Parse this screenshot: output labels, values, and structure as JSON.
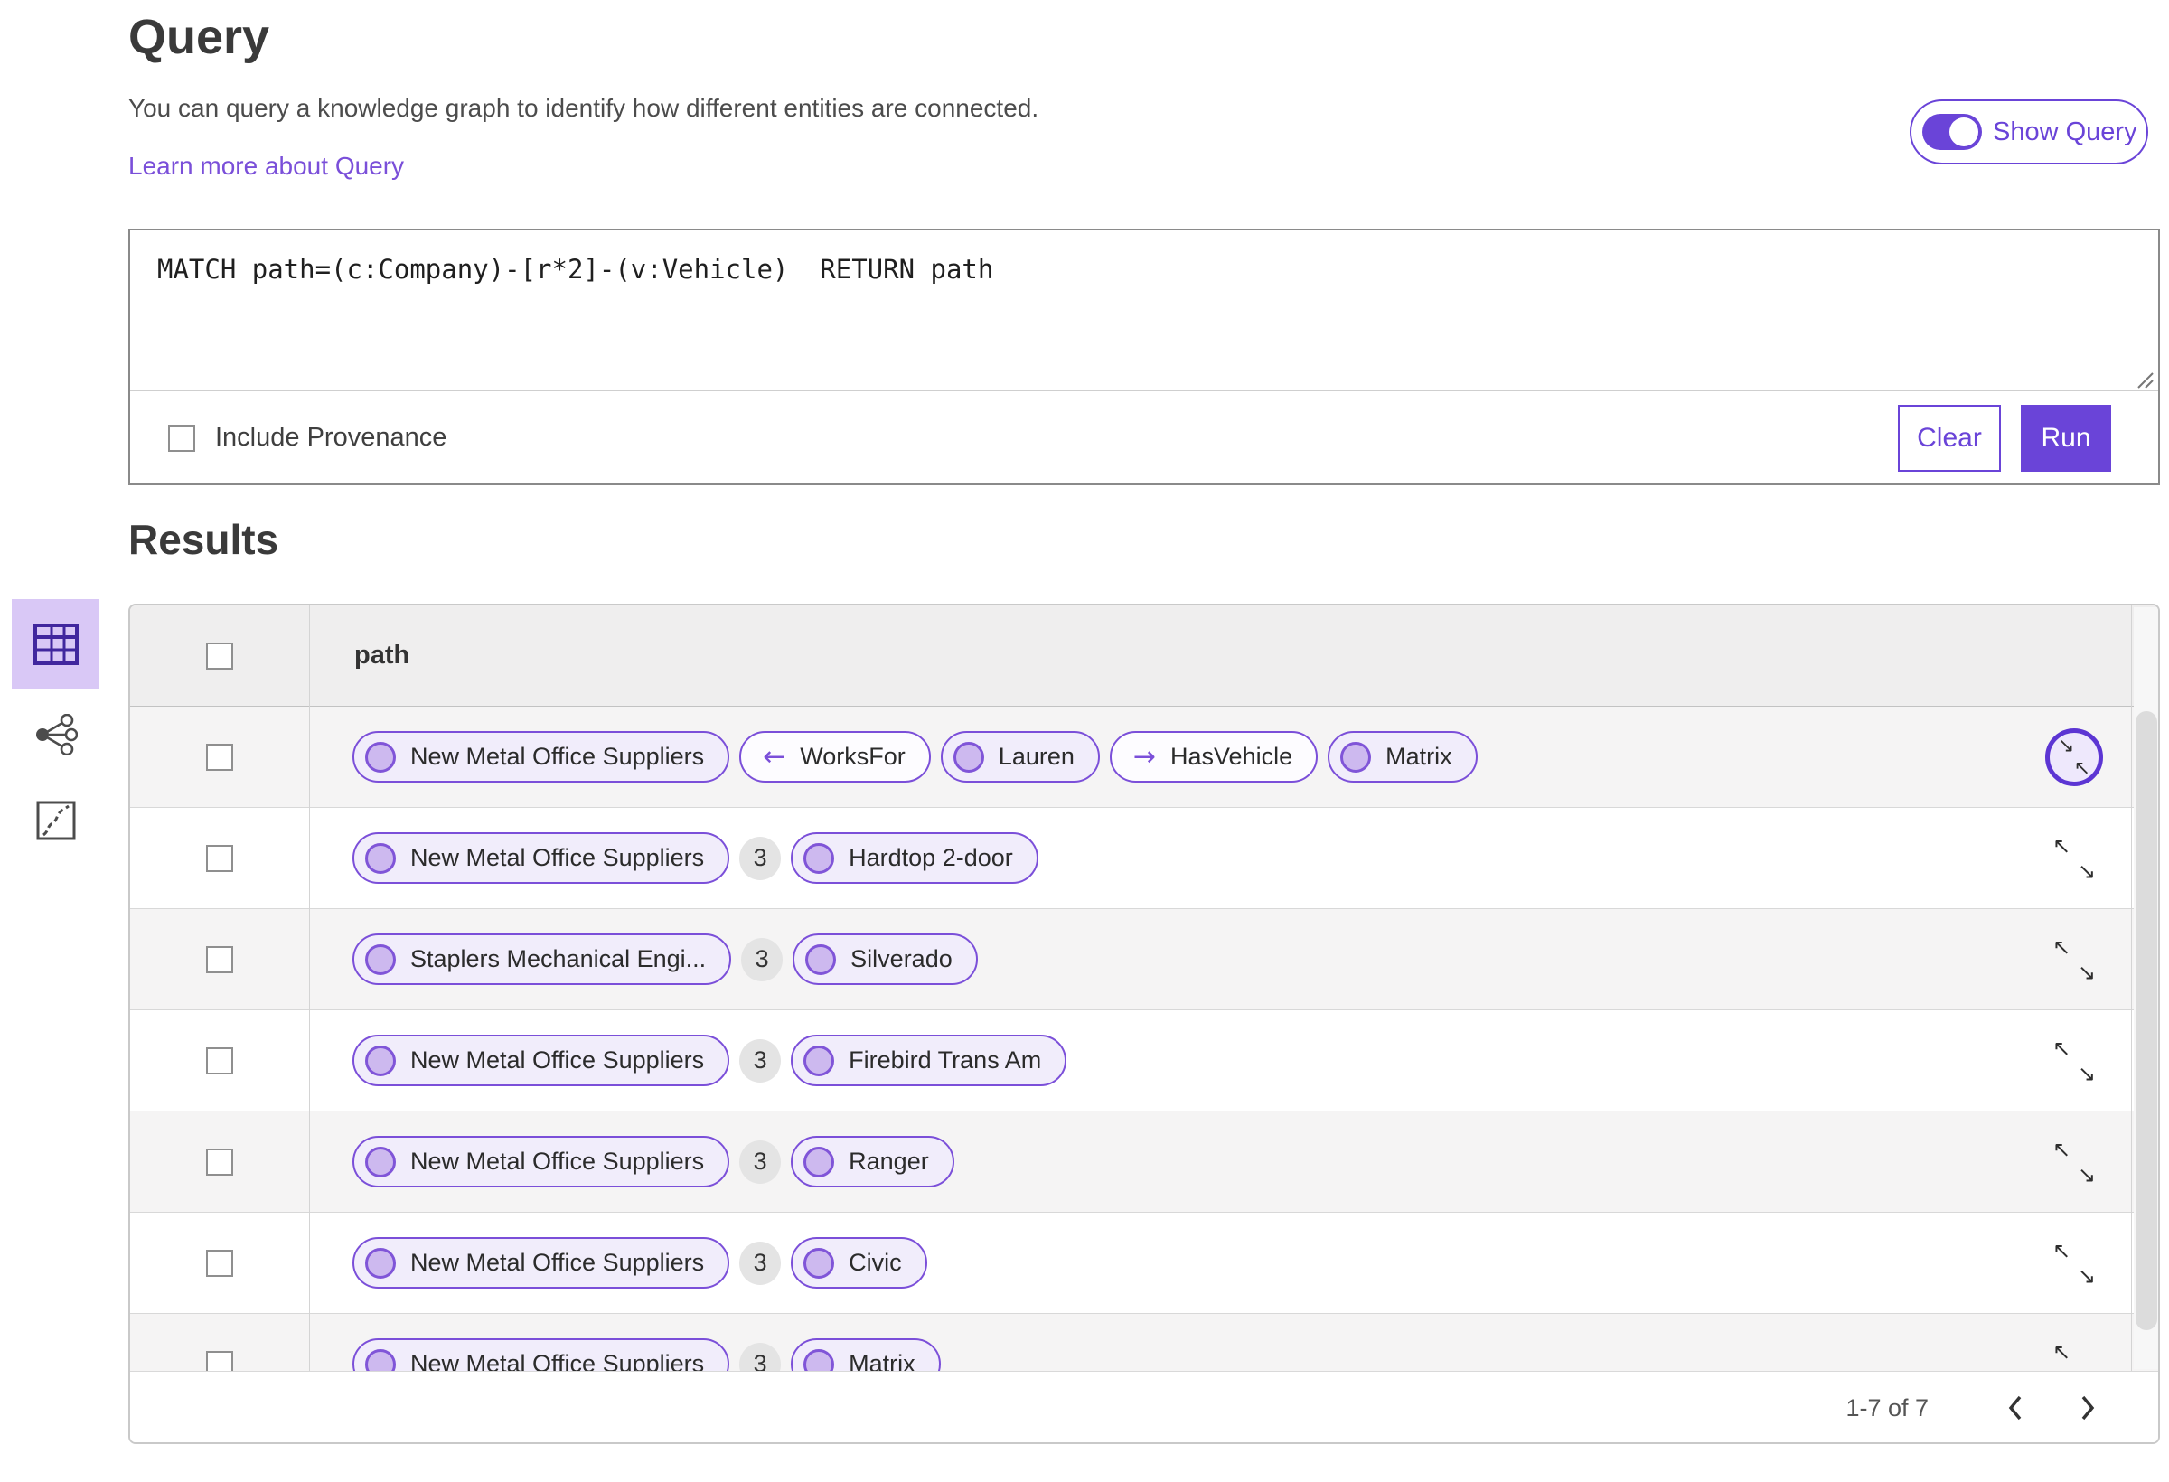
{
  "page": {
    "title": "Query",
    "description": "You can query a knowledge graph to identify how different entities are connected.",
    "learn_more_link": "Learn more about Query",
    "show_query_label": "Show Query",
    "show_query_toggle_state": "on"
  },
  "query": {
    "text": "MATCH path=(c:Company)-[r*2]-(v:Vehicle)  RETURN path",
    "include_provenance_label": "Include Provenance",
    "include_provenance_checked": false,
    "clear_label": "Clear",
    "run_label": "Run"
  },
  "results": {
    "heading": "Results",
    "column_header": "path",
    "view_switcher": [
      "table-view",
      "link-chart-view",
      "map-view"
    ],
    "selected_view": "table-view",
    "rows": [
      {
        "cells": [
          {
            "kind": "entity",
            "label": "New Metal Office Suppliers"
          },
          {
            "kind": "relationship",
            "arrow": "←",
            "label": "WorksFor"
          },
          {
            "kind": "entity",
            "label": "Lauren"
          },
          {
            "kind": "relationship",
            "arrow": "→",
            "label": "HasVehicle"
          },
          {
            "kind": "entity",
            "label": "Matrix"
          }
        ],
        "expand_state": "focused-collapse"
      },
      {
        "cells": [
          {
            "kind": "entity",
            "label": "New Metal Office Suppliers"
          },
          {
            "kind": "count",
            "label": "3"
          },
          {
            "kind": "entity",
            "label": "Hardtop 2-door"
          }
        ]
      },
      {
        "cells": [
          {
            "kind": "entity",
            "label": "Staplers Mechanical Engi..."
          },
          {
            "kind": "count",
            "label": "3"
          },
          {
            "kind": "entity",
            "label": "Silverado"
          }
        ]
      },
      {
        "cells": [
          {
            "kind": "entity",
            "label": "New Metal Office Suppliers"
          },
          {
            "kind": "count",
            "label": "3"
          },
          {
            "kind": "entity",
            "label": "Firebird Trans Am"
          }
        ]
      },
      {
        "cells": [
          {
            "kind": "entity",
            "label": "New Metal Office Suppliers"
          },
          {
            "kind": "count",
            "label": "3"
          },
          {
            "kind": "entity",
            "label": "Ranger"
          }
        ]
      },
      {
        "cells": [
          {
            "kind": "entity",
            "label": "New Metal Office Suppliers"
          },
          {
            "kind": "count",
            "label": "3"
          },
          {
            "kind": "entity",
            "label": "Civic"
          }
        ]
      },
      {
        "cells": [
          {
            "kind": "entity",
            "label": "New Metal Office Suppliers"
          },
          {
            "kind": "count",
            "label": "3"
          },
          {
            "kind": "entity",
            "label": "Matrix"
          }
        ]
      }
    ],
    "pagination": {
      "range_label": "1-7 of 7"
    }
  },
  "icons": {
    "arrow_left": "←",
    "arrow_right": "→",
    "expand_nw": "↖",
    "expand_se": "↘"
  },
  "colors": {
    "accent_purple": "#6a44d8",
    "pill_border": "#7b4fd9",
    "pill_entity_bg": "#f1edfb",
    "node_dot_fill": "#cdb9ef",
    "selected_view_bg": "#d9c8f6",
    "link": "#7a4fd9",
    "row_stripe": "#f5f4f4",
    "header_bg": "#efeeee"
  }
}
